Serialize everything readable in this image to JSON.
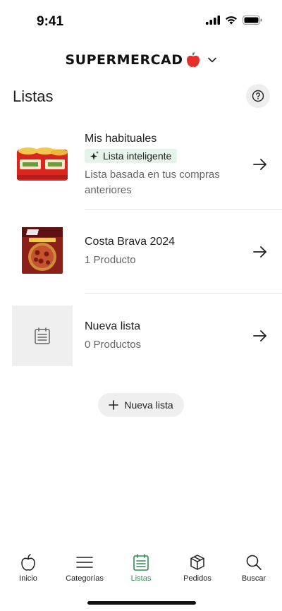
{
  "status_bar": {
    "time": "9:41"
  },
  "header": {
    "brand": "SUPERMERCADO",
    "brand_main": "SUPERMERCAD"
  },
  "page": {
    "title": "Listas"
  },
  "lists": [
    {
      "title": "Mis habituales",
      "badge": "Lista inteligente",
      "subtitle": "Lista basada en tus compras anteriores",
      "thumb": "canned-food-pack-image"
    },
    {
      "title": "Costa Brava 2024",
      "subtitle": "1 Producto",
      "thumb": "pizza-box-image"
    },
    {
      "title": "Nueva lista",
      "subtitle": "0 Productos",
      "thumb": "list-placeholder-icon"
    }
  ],
  "actions": {
    "new_list": "Nueva lista"
  },
  "bottom_nav": {
    "active": "Listas",
    "items": [
      {
        "label": "Inicio",
        "icon": "apple-icon"
      },
      {
        "label": "Categorías",
        "icon": "menu-icon"
      },
      {
        "label": "Listas",
        "icon": "list-icon"
      },
      {
        "label": "Pedidos",
        "icon": "box-icon"
      },
      {
        "label": "Buscar",
        "icon": "search-icon"
      }
    ]
  },
  "colors": {
    "accent": "#2e8b57",
    "brand_red": "#e8302a",
    "badge_bg": "#e6f3ea"
  }
}
